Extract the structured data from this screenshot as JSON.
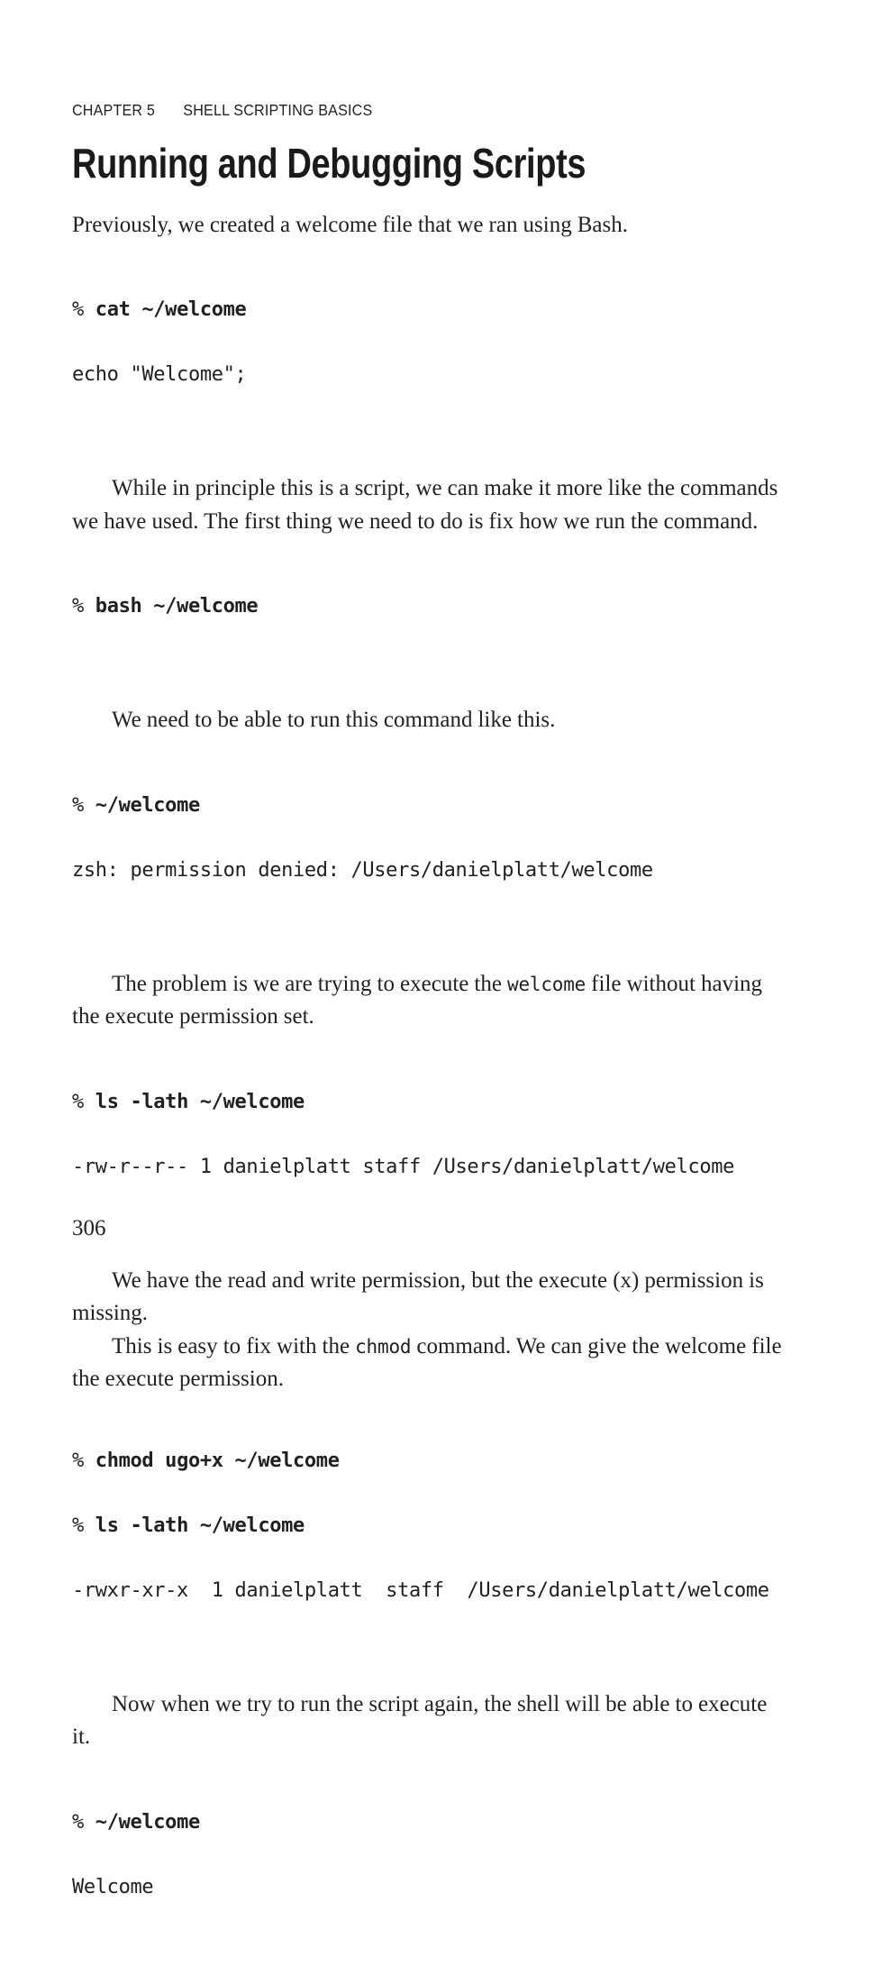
{
  "header": {
    "chapter_label": "CHAPTER 5",
    "chapter_title": "SHELL SCRIPTING BASICS"
  },
  "title": "Running and Debugging Scripts",
  "blocks": {
    "p_intro": "Previously, we created a welcome file that we ran using Bash.",
    "code_cat": {
      "prompt": "% ",
      "command": "cat ~/welcome",
      "output": "echo \"Welcome\";"
    },
    "p_while": "While in principle this is a script, we can make it more like the commands we have used. The first thing we need to do is fix how we run the command.",
    "code_bash": {
      "prompt": "% ",
      "command": "bash ~/welcome"
    },
    "p_need": "We need to be able to run this command like this.",
    "code_denied": {
      "prompt": "% ",
      "command": "~/welcome",
      "output": "zsh: permission denied: /Users/danielplatt/welcome"
    },
    "p_problem_part1": "The problem is we are trying to execute the ",
    "p_problem_code": "welcome",
    "p_problem_part2": " file without having the execute permission set.",
    "code_ls": {
      "prompt": "% ",
      "command": "ls -lath ~/welcome",
      "output": "-rw-r--r-- 1 danielplatt staff /Users/danielplatt/welcome"
    },
    "p_readwrite": "We have the read and write permission, but the execute (x) permission is missing.",
    "p_chmod_part1": "This is easy to fix with the ",
    "p_chmod_code": "chmod",
    "p_chmod_part2": " command. We can give the welcome file the execute permission.",
    "code_chmod": {
      "prompt1": "% ",
      "command1": "chmod ugo+x ~/welcome",
      "prompt2": "% ",
      "command2": "ls -lath ~/welcome",
      "output": "-rwxr-xr-x  1 danielplatt  staff  /Users/danielplatt/welcome"
    },
    "p_now": "Now when we try to run the script again, the shell will be able to execute it.",
    "code_run": {
      "prompt": "% ",
      "command": "~/welcome",
      "output": "Welcome"
    }
  },
  "folio": "306"
}
